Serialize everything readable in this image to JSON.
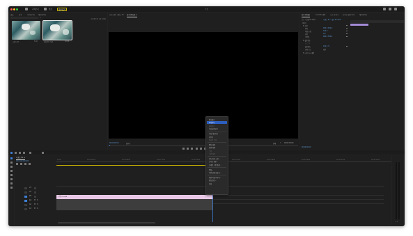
{
  "colors": {
    "window_bg": "#232323",
    "panel_bg": "#1f1f1f",
    "accent_blue": "#2d5fc0",
    "timecode_blue": "#5d9bd8",
    "clip_pink": "#e8c8e6",
    "workspace_highlight": "#c9b400",
    "playhead": "#3e7fd6",
    "purple_bar": "#a58ad8"
  },
  "titlebar": {
    "title": "수정",
    "tabs": [
      "가져오기",
      "편집",
      "내보내기"
    ],
    "active_tab": "내보내기"
  },
  "project_panel": {
    "tabs": [
      "소스",
      "효과",
      "라이브러리",
      "메타데이터"
    ],
    "search_placeholder": "",
    "item_count": "2개 항목 중 1개 선택됨",
    "items": [
      {
        "name": "시퀀스 01",
        "duration": "5:00"
      },
      {
        "name": "클립 01.mp4",
        "duration": "10:00"
      }
    ]
  },
  "program_monitor": {
    "tabs": [
      "프로그램: 시퀀스 01",
      "효과 컨트롤 ≡"
    ],
    "timecode_left": "00:00:00:00",
    "fit": "맞추기",
    "quality": "전체",
    "timecode_right": "00:00:05:00"
  },
  "effect_controls": {
    "tabs": [
      "효과 컨트롤",
      "Lumetri 범위",
      "소스 모니터",
      "오디오 클립 믹서",
      "메타데이터"
    ],
    "clip_label": "소스 • 클립 01.mp4",
    "sequence_label": "시퀀스 01 • 클립 01.mp4",
    "sections": [
      {
        "label": "비디오",
        "value": ""
      },
      {
        "label": "fx 모션",
        "value": ""
      },
      {
        "label": "위치",
        "value": "960.0  540.0"
      },
      {
        "label": "비율 조정",
        "value": "100.0"
      },
      {
        "label": "회전",
        "value": "0.0"
      },
      {
        "label": "기준점",
        "value": "960.0  540.0"
      },
      {
        "label": "fx 불투명도",
        "value": ""
      },
      {
        "label": "불투명도",
        "value": "100.0 %"
      },
      {
        "label": "혼합 모드",
        "value": "표준"
      },
      {
        "label": "fx 시간 다시 매핑",
        "value": ""
      }
    ],
    "timecode": "00:00:00:00"
  },
  "context_menu": {
    "items": [
      {
        "label": "잘라내기",
        "dim": false
      },
      {
        "label": "복사하기",
        "dim": false,
        "highlight": true
      },
      {
        "label": "붙여넣기",
        "dim": true
      },
      {
        "label": "속성 붙여넣기",
        "dim": false
      },
      {
        "label": "",
        "separator": true
      },
      {
        "label": "속성 제거하기",
        "dim": false
      },
      {
        "label": "지우기",
        "dim": false
      },
      {
        "label": "잔물결 삭제",
        "dim": true
      },
      {
        "label": "",
        "separator": true
      },
      {
        "label": "편집 해제",
        "dim": false
      },
      {
        "label": "연결 해제",
        "dim": false
      },
      {
        "label": "그룹",
        "dim": true
      },
      {
        "label": "그룹 해제",
        "dim": true
      },
      {
        "label": "",
        "separator": true
      },
      {
        "label": "속도/지속 시간...",
        "dim": false
      },
      {
        "label": "오디오 게인...",
        "dim": false
      },
      {
        "label": "프레임 고정 옵션...",
        "dim": false
      },
      {
        "label": "",
        "separator": true
      },
      {
        "label": "중첩...",
        "dim": false
      },
      {
        "label": "하위 클립 만들기...",
        "dim": false
      },
      {
        "label": "",
        "separator": true
      },
      {
        "label": "파일 이름 바꾸기...",
        "dim": false
      },
      {
        "label": "편집 원본...",
        "dim": false
      },
      {
        "label": "속성",
        "dim": false
      }
    ]
  },
  "timeline": {
    "sequence_name": "시퀀스 01 ≡",
    "timecode": "00:00:00:00",
    "ruler": [
      "00:00",
      "00:00:04:00",
      "00:00:08:00",
      "00:00:12:00",
      "00:00:16:00",
      "00:00:20:00",
      "00:00:24:00",
      "00:00:28:00",
      "00:00:32:00",
      "00:00:36:00"
    ],
    "tracks": [
      "V3",
      "V2",
      "V1",
      "A1",
      "A2",
      "A3"
    ],
    "clip_name": "클립 01.mp4"
  }
}
